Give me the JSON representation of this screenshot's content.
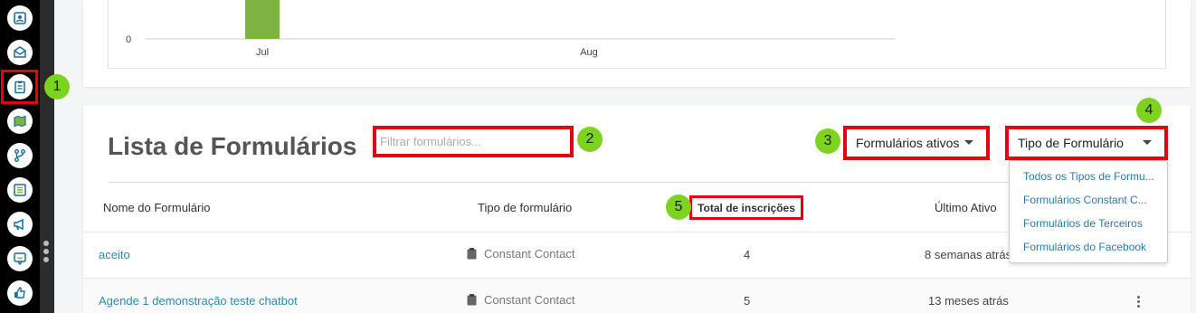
{
  "sidebar": {
    "icons": [
      "contacts-icon",
      "email-icon",
      "forms-icon",
      "map-icon",
      "automation-icon",
      "lists-icon",
      "campaigns-icon",
      "chat-icon",
      "like-icon"
    ],
    "active_index": 2
  },
  "badges": [
    "1",
    "2",
    "3",
    "4",
    "5"
  ],
  "chart_data": {
    "type": "bar",
    "categories": [
      "Jul",
      "Aug"
    ],
    "y_tick_labels": [
      "0"
    ],
    "bar_color": "#7cb342",
    "title": "",
    "xlabel": "",
    "ylabel": ""
  },
  "list": {
    "title": "Lista de Formulários",
    "filter_placeholder": "Filtrar formulários...",
    "status_dropdown": "Formulários ativos",
    "type_dropdown": "Tipo de Formulário",
    "columns": {
      "name": "Nome do Formulário",
      "type": "Tipo de formulário",
      "total": "Total de inscrições",
      "last": "Último Ativo"
    },
    "rows": [
      {
        "name": "aceito",
        "type": "Constant Contact",
        "total": "4",
        "last": "8 semanas atrás"
      },
      {
        "name": "Agende 1 demonstração teste chatbot",
        "type": "Constant Contact",
        "total": "5",
        "last": "13 meses atrás"
      }
    ]
  },
  "type_menu": {
    "items": [
      "Todos os Tipos de Formu...",
      "Formulários Constant C...",
      "Formulários de Terceiros",
      "Formulários do Facebook"
    ]
  },
  "colors": {
    "accent_green": "#7ed321",
    "highlight_red": "#e60012",
    "link_blue": "#2a8cb5"
  }
}
